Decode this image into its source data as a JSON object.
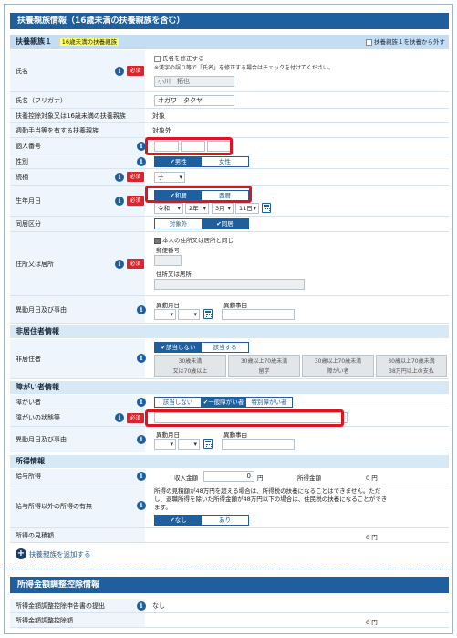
{
  "section1": {
    "title": "扶養親族情報（16歳未満の扶養親族を含む）",
    "sub_title": "扶養親族１",
    "sub_badge": "16歳未満の扶養親族",
    "remove_label": "扶養親族１を扶養から外す"
  },
  "labels": {
    "name": "氏名",
    "name_kana": "氏名（フリガナ）",
    "under16": "扶養控除対象又は16歳未満の扶養親族",
    "allowance": "週勤手当等を有する扶養親族",
    "my_number": "個人番号",
    "gender": "性別",
    "relation": "続柄",
    "birth": "生年月日",
    "cohabit": "同居区分",
    "address": "住所又は居所",
    "change": "異動月日及び事由",
    "nonresident": "非居住者",
    "disabled": "障がい者",
    "disabled_state": "障がいの状態等",
    "change2": "異動月日及び事由",
    "salary": "給与所得",
    "other_income": "給与所得以外の所得の有無",
    "estimate": "所得の見積額",
    "adj_submit": "所得金額調整控除申告書の提出",
    "adj_amount": "所得金額調整控除額"
  },
  "required_label": "必須",
  "info_glyph": "i",
  "fields": {
    "fix_name_label": "氏名を修正する",
    "fix_name_note": "※漢字の誤り等で「氏名」を修正する場合はチェックを付けてください。",
    "name_value": "小川　拓也",
    "kana_value": "オガワ　タクヤ",
    "under16_value": "対象",
    "allowance_value": "対象外",
    "gender_options": [
      "✔男性",
      "女性"
    ],
    "relation_value": "子",
    "era_options": [
      "✔和暦",
      "西暦"
    ],
    "era_value": "令和",
    "year_value": "2年",
    "month_value": "3月",
    "day_value": "11日",
    "cohabit_options": [
      "対象外",
      "✔同居"
    ],
    "same_address_label": "本人の住所又は居所と同じ",
    "postal_label": "郵便番号",
    "address_label": "住所又は居所",
    "change_date_label": "異動月日",
    "change_reason_label": "異動事由",
    "nonresident_options": [
      "✔該当しない",
      "該当する"
    ],
    "nonresident_sub": [
      [
        "30歳未満",
        "又は70歳以上"
      ],
      [
        "30歳以上70歳未満",
        "留学"
      ],
      [
        "30歳以上70歳未満",
        "障がい者"
      ],
      [
        "30歳以上70歳未満",
        "38万円以上の支払"
      ]
    ],
    "disabled_options": [
      "該当しない",
      "✔一般障がい者",
      "特別障がい者"
    ],
    "income_label": "収入金額",
    "income_value": "0",
    "yen": "円",
    "salary_income_label": "所得金額",
    "salary_income_value": "0 円",
    "other_note": "所得の見積額が48万円を超える場合は、所得税の扶養になることはできません。ただし、退職所得を除いた所得金額が48万円以下の場合は、住民税の扶養になることができます。",
    "other_options": [
      "✔なし",
      "あり"
    ],
    "estimate_value": "0 円",
    "adj_submit_value": "なし",
    "adj_amount_value": "0 円"
  },
  "sub_heads": {
    "nonresident": "非居住者情報",
    "disabled": "障がい者情報",
    "income": "所得情報"
  },
  "add_label": "扶養親族を追加する",
  "section2": {
    "title": "所得金額調整控除情報"
  }
}
